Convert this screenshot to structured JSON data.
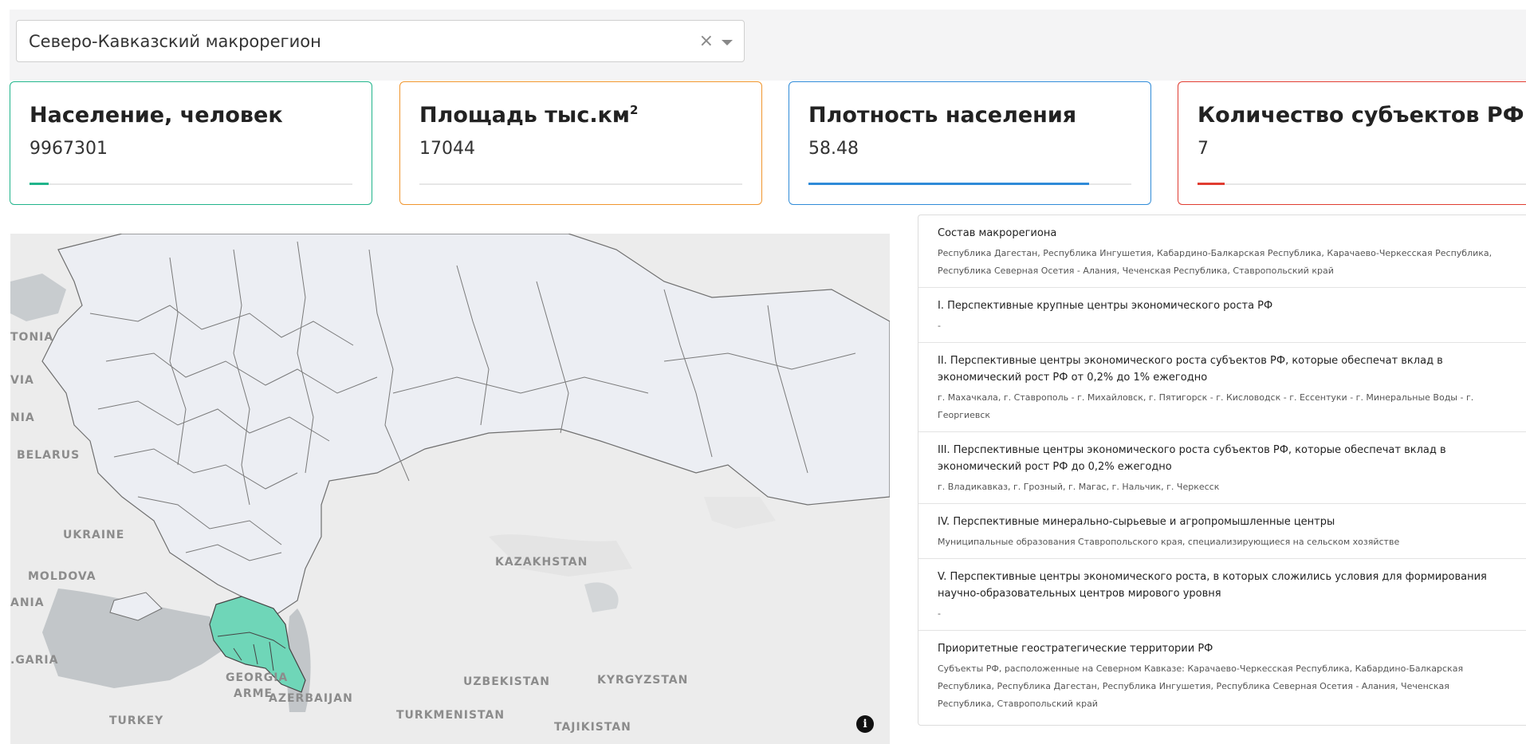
{
  "filter": {
    "selected": "Северо-Кавказский макрорегион",
    "clear_icon": "×",
    "caret_icon": "chevron-down-icon"
  },
  "cards": [
    {
      "title": "Население, человек",
      "sup": "",
      "value": "9967301",
      "progress": 0.06,
      "color": "#20b48b"
    },
    {
      "title": "Площадь тыс.км",
      "sup": "2",
      "value": "17044",
      "progress": 0.0,
      "color": "#f0952d"
    },
    {
      "title": "Плотность населения",
      "sup": "",
      "value": "58.48",
      "progress": 0.87,
      "color": "#2f8bd8"
    },
    {
      "title": "Количество субъектов РФ",
      "sup": "",
      "value": "7",
      "progress": 0.08,
      "color": "#e03c31"
    }
  ],
  "map": {
    "labels": {
      "tonia": "TONIA",
      "via": "VIA",
      "nia": "NIA",
      "belarus": "BELARUS",
      "ukraine": "UKRAINE",
      "moldova": "MOLDOVA",
      "ania": "ANIA",
      "garia": ".GARIA",
      "kazakhstan": "KAZAKHSTAN",
      "georgia": "GEORGIA",
      "armenia": "ARME",
      "azerbaijan": "AZERBAIJAN",
      "uzbekistan": "UZBEKISTAN",
      "kyrgyzstan": "KYRGYZSTAN",
      "turkey": "TURKEY",
      "turkmenistan": "TURKMENISTAN",
      "tajikistan": "TAJIKISTAN"
    },
    "info_icon": "i",
    "highlight_color": "#6fd6b8",
    "region_color": "#eceef3"
  },
  "panel": {
    "items": [
      {
        "title": "Состав макрорегиона",
        "desc": "Республика Дагестан, Республика Ингушетия, Кабардино-Балкарская Республика, Карачаево-Черкесская Республика, Республика Северная Осетия - Алания, Чеченская Республика, Ставропольский край"
      },
      {
        "title": "I. Перспективные крупные центры экономического роста РФ",
        "desc": "-"
      },
      {
        "title": "II. Перспективные центры экономического роста субъектов РФ, которые обеспечат вклад в экономический рост РФ от 0,2% до 1% ежегодно",
        "desc": "г. Махачкала, г. Ставрополь - г. Михайловск, г. Пятигорск - г. Кисловодск - г. Ессентуки - г. Минеральные Воды - г. Георгиевск"
      },
      {
        "title": "III. Перспективные центры экономического роста субъектов РФ, которые обеспечат вклад в экономический рост РФ до 0,2% ежегодно",
        "desc": "г. Владикавказ, г. Грозный, г. Магас, г. Нальчик, г. Черкесск"
      },
      {
        "title": "IV. Перспективные минерально-сырьевые и агропромышленные центры",
        "desc": "Муниципальные образования Ставропольского края, специализирующиеся на сельском хозяйстве"
      },
      {
        "title": "V. Перспективные центры экономического роста, в которых сложились условия для формирования научно-образовательных центров мирового уровня",
        "desc": "-"
      },
      {
        "title": "Приоритетные геостратегические территории РФ",
        "desc": "Субъекты РФ, расположенные на Северном Кавказе: Карачаево-Черкесская Республика, Кабардино-Балкарская Республика, Республика Дагестан, Республика Ингушетия, Республика Северная Осетия - Алания, Чеченская Республика, Ставропольский край"
      }
    ]
  }
}
